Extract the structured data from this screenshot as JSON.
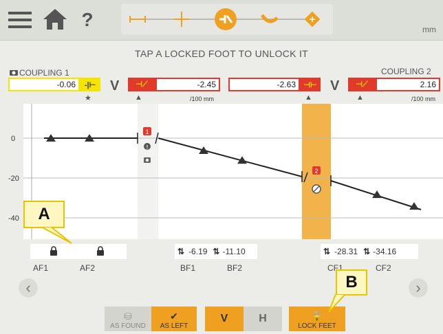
{
  "header": {
    "menu_icon": "hamburger-menu-icon",
    "home_icon": "home-icon",
    "help_label": "?",
    "steps": [
      "dimensions-icon",
      "measure-icon",
      "result-icon",
      "correct-icon",
      "tape-icon"
    ],
    "unit": "mm"
  },
  "banner": "TAP A LOCKED FOOT TO UNLOCK IT",
  "coupling1": {
    "name": "COUPLING 1",
    "gap_value": "-0.06",
    "angle_value": "-2.45",
    "unit_label": "/100 mm",
    "V": "V"
  },
  "coupling2": {
    "name": "COUPLING 2",
    "offset_value": "-2.63",
    "angle_value": "2.16",
    "unit_label": "/100 mm",
    "V": "V"
  },
  "chart_data": {
    "type": "line",
    "y_ticks": [
      "0",
      "-20",
      "-40"
    ],
    "feet": [
      {
        "name": "AF1",
        "value": 0,
        "locked": true
      },
      {
        "name": "AF2",
        "value": 0,
        "locked": true
      },
      {
        "name": "BF1",
        "value": -6.19,
        "locked": false
      },
      {
        "name": "BF2",
        "value": -11.1,
        "locked": false
      },
      {
        "name": "CF1",
        "value": -28.31,
        "locked": false
      },
      {
        "name": "CF2",
        "value": -34.16,
        "locked": false
      }
    ],
    "markers": [
      "1",
      "2"
    ]
  },
  "feet_labels": {
    "af1": "AF1",
    "af2": "AF2",
    "bf1": "BF1",
    "bf2": "BF2",
    "cf1": "CF1",
    "cf2": "CF2"
  },
  "feet_values": {
    "bf1": "-6.19",
    "bf2": "-11.10",
    "cf1": "-28.31",
    "cf2": "-34.16"
  },
  "buttons": {
    "as_found": "AS FOUND",
    "as_left": "AS LEFT",
    "v": "V",
    "h": "H",
    "lock_feet": "LOCK FEET"
  },
  "callouts": {
    "a": "A",
    "b": "B"
  },
  "colors": {
    "accent": "#f0a020",
    "highlight": "#f4e400",
    "red": "#e23a2a",
    "orange_band": "#f2b34a"
  }
}
